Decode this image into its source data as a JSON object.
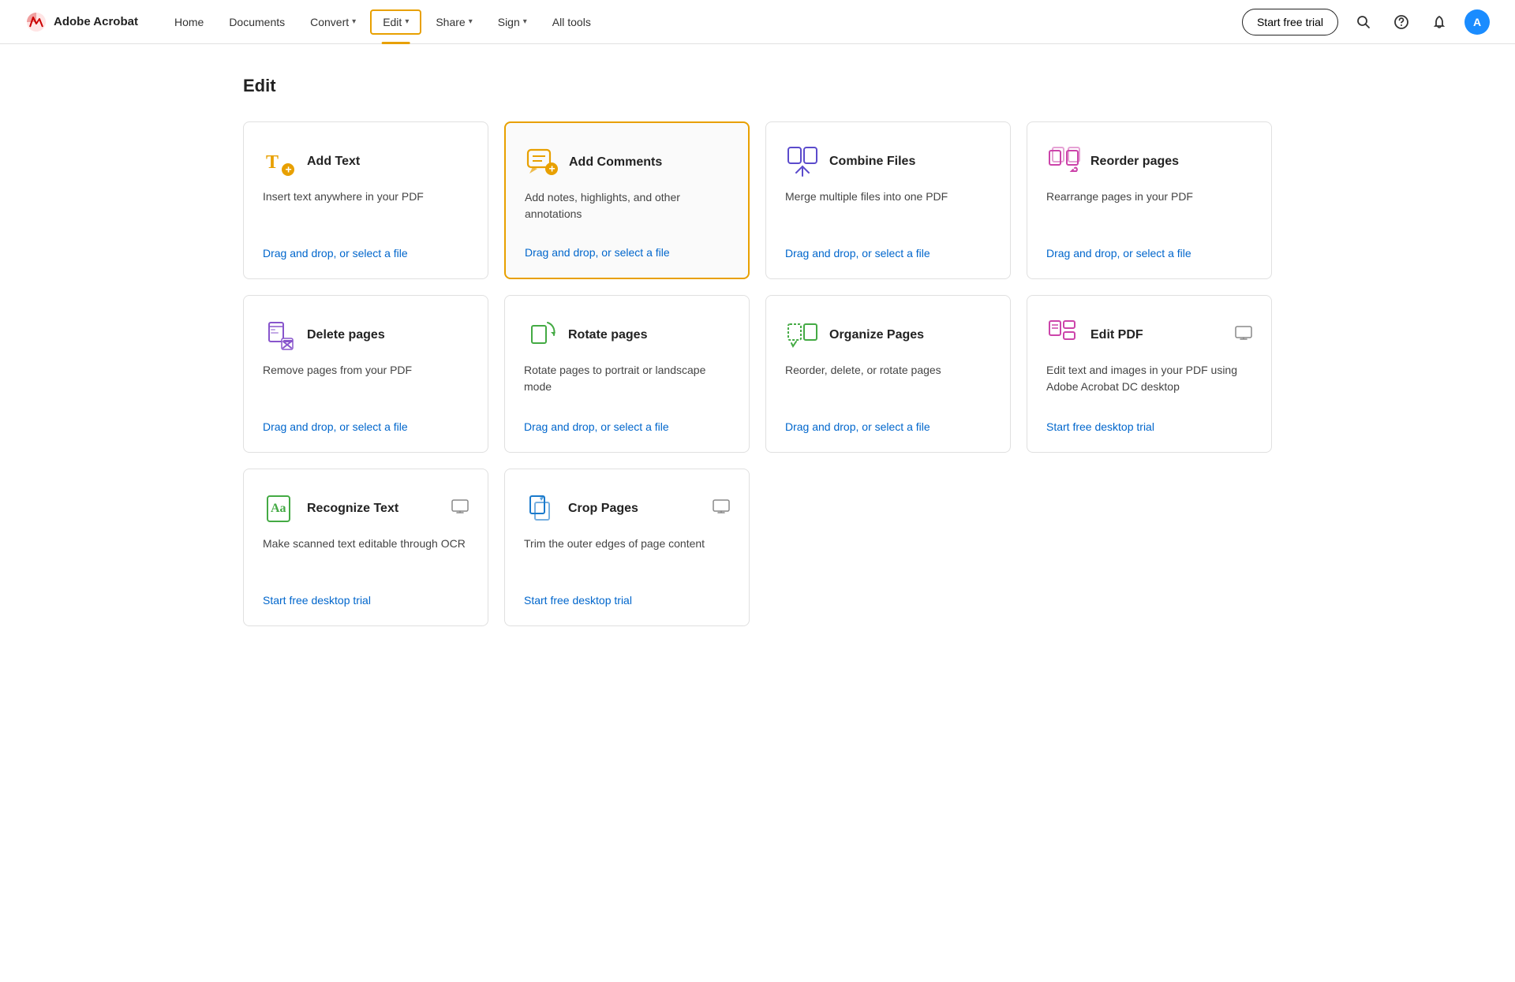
{
  "header": {
    "logo_text": "Adobe Acrobat",
    "nav": [
      {
        "label": "Home",
        "has_dropdown": false,
        "active": false
      },
      {
        "label": "Documents",
        "has_dropdown": false,
        "active": false
      },
      {
        "label": "Convert",
        "has_dropdown": true,
        "active": false
      },
      {
        "label": "Edit",
        "has_dropdown": true,
        "active": true
      },
      {
        "label": "Share",
        "has_dropdown": true,
        "active": false
      },
      {
        "label": "Sign",
        "has_dropdown": true,
        "active": false
      },
      {
        "label": "All tools",
        "has_dropdown": false,
        "active": false
      }
    ],
    "trial_button": "Start free trial",
    "avatar_letter": "A"
  },
  "page": {
    "title": "Edit"
  },
  "cards": [
    {
      "id": "add-text",
      "title": "Add Text",
      "desc": "Insert text anywhere in your PDF",
      "link": "Drag and drop, or select a file",
      "link_type": "blue",
      "highlighted": false,
      "desktop": false
    },
    {
      "id": "add-comments",
      "title": "Add Comments",
      "desc": "Add notes, highlights, and other annotations",
      "link": "Drag and drop, or select a file",
      "link_type": "blue",
      "highlighted": true,
      "desktop": false
    },
    {
      "id": "combine-files",
      "title": "Combine Files",
      "desc": "Merge multiple files into one PDF",
      "link": "Drag and drop, or select a file",
      "link_type": "blue",
      "highlighted": false,
      "desktop": false
    },
    {
      "id": "reorder-pages",
      "title": "Reorder pages",
      "desc": "Rearrange pages in your PDF",
      "link": "Drag and drop, or select a file",
      "link_type": "blue",
      "highlighted": false,
      "desktop": false
    },
    {
      "id": "delete-pages",
      "title": "Delete pages",
      "desc": "Remove pages from your PDF",
      "link": "Drag and drop, or select a file",
      "link_type": "blue",
      "highlighted": false,
      "desktop": false
    },
    {
      "id": "rotate-pages",
      "title": "Rotate pages",
      "desc": "Rotate pages to portrait or landscape mode",
      "link": "Drag and drop, or select a file",
      "link_type": "blue",
      "highlighted": false,
      "desktop": false
    },
    {
      "id": "organize-pages",
      "title": "Organize Pages",
      "desc": "Reorder, delete, or rotate pages",
      "link": "Drag and drop, or select a file",
      "link_type": "blue",
      "highlighted": false,
      "desktop": false
    },
    {
      "id": "edit-pdf",
      "title": "Edit PDF",
      "desc": "Edit text and images in your PDF using Adobe Acrobat DC desktop",
      "link": "Start free desktop trial",
      "link_type": "blue",
      "highlighted": false,
      "desktop": true
    },
    {
      "id": "recognize-text",
      "title": "Recognize Text",
      "desc": "Make scanned text editable through OCR",
      "link": "Start free desktop trial",
      "link_type": "blue",
      "highlighted": false,
      "desktop": true
    },
    {
      "id": "crop-pages",
      "title": "Crop Pages",
      "desc": "Trim the outer edges of page content",
      "link": "Start free desktop trial",
      "link_type": "blue",
      "highlighted": false,
      "desktop": true
    }
  ]
}
